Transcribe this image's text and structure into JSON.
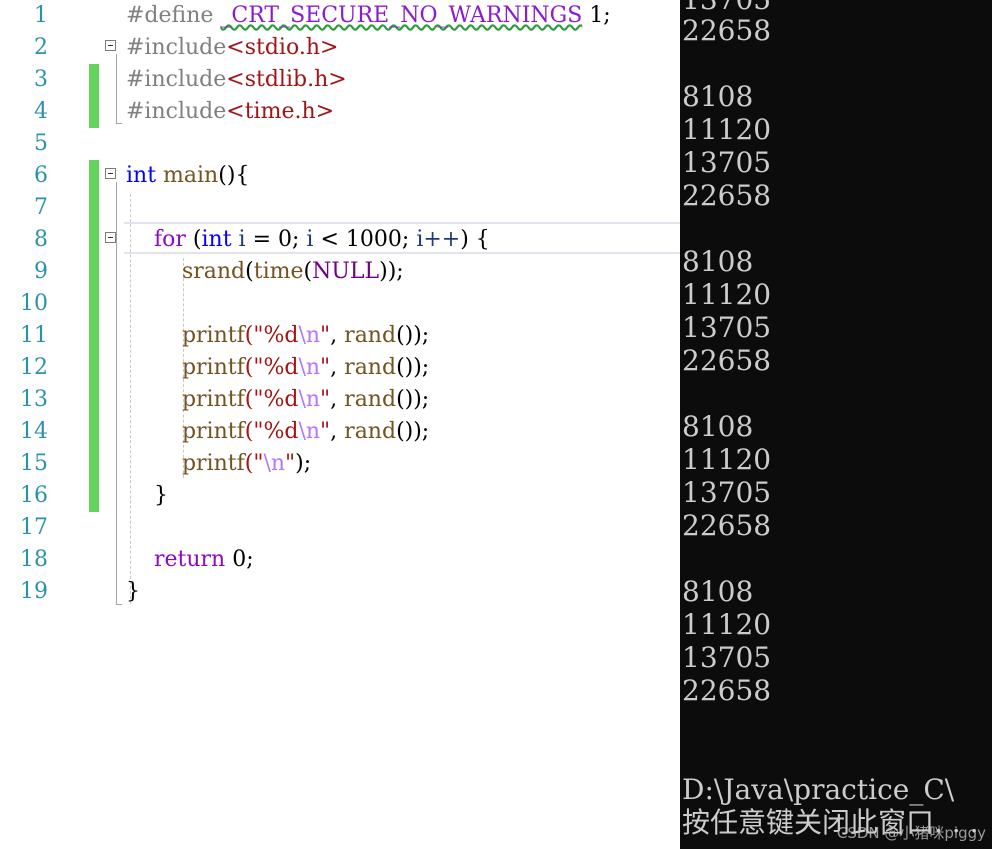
{
  "editor": {
    "line_numbers": [
      "1",
      "2",
      "3",
      "4",
      "5",
      "6",
      "7",
      "8",
      "9",
      "10",
      "11",
      "12",
      "13",
      "14",
      "15",
      "16",
      "17",
      "18",
      "19"
    ],
    "tokens": {
      "hash_define": "#define",
      "macro_secure": "_CRT_SECURE_NO_WARNINGS",
      "one": "1;",
      "hash_include": "#include",
      "hdr_stdio": "<stdio.h>",
      "hdr_stdlib": "<stdlib.h>",
      "hdr_time": "<time.h>",
      "kw_int": "int",
      "fn_main": "main",
      "paren_brace": "(){",
      "kw_for": "for",
      "for_open": "(",
      "var_i": "i",
      "assign_zero": "= 0;",
      "less_than": "<",
      "limit": "1000;",
      "incr": "i++",
      "close_brace_open": ") {",
      "fn_srand": "srand",
      "fn_time": "time",
      "null": "NULL",
      "srand_close": "));",
      "fn_printf": "printf",
      "str_open": "(\"",
      "fmt_d": "%d",
      "esc_n": "\\n",
      "str_close": "\"",
      "comma": ",",
      "fn_rand": "rand",
      "rand_close": "());",
      "paren_close": ");",
      "brace_close": "}",
      "kw_return": "return",
      "zero": "0;"
    }
  },
  "console": {
    "lines": [
      "13705",
      "22658",
      "",
      "8108",
      "11120",
      "13705",
      "22658",
      "",
      "8108",
      "11120",
      "13705",
      "22658",
      "",
      "8108",
      "11120",
      "13705",
      "22658",
      "",
      "8108",
      "11120",
      "13705",
      "22658",
      "",
      "",
      "D:\\Java\\practice_C\\",
      "按任意键关闭此窗口. . ."
    ],
    "watermark": "CSDN @小猪咪piggy"
  }
}
